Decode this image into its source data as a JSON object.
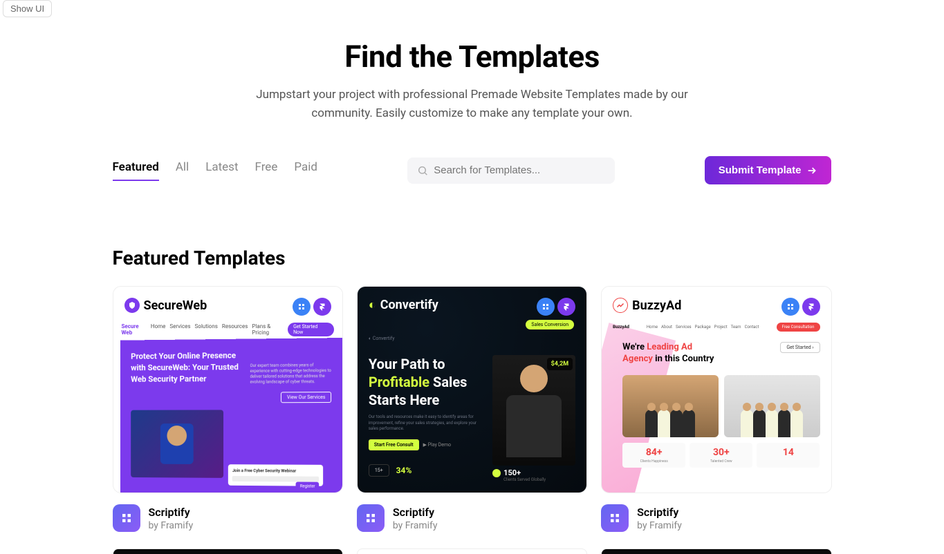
{
  "showUiLabel": "Show UI",
  "hero": {
    "title": "Find the Templates",
    "subtitle": "Jumpstart your project with professional Premade Website Templates made by our community. Easily customize to make any template your own."
  },
  "tabs": {
    "items": [
      "Featured",
      "All",
      "Latest",
      "Free",
      "Paid"
    ],
    "activeIndex": 0
  },
  "search": {
    "placeholder": "Search for Templates..."
  },
  "submitLabel": "Submit Template",
  "sectionTitle": "Featured Templates",
  "cards": [
    {
      "brand": "SecureWeb",
      "brandColor": "#7c3aed",
      "title": "Scriptify",
      "author": "by Framify",
      "preview": {
        "brandSmall": "Secure Web",
        "navLinks": [
          "Home",
          "Services",
          "Solutions",
          "Resources",
          "Plans & Pricing"
        ],
        "ctaLabel": "Get Started Now",
        "headline": "Protect Your Online Presence with SecureWeb: Your Trusted Web Security Partner",
        "desc": "Our expert team combines years of experience with cutting-edge technologies to deliver tailored solutions that address the evolving landscape of cyber threats.",
        "btnOutline": "View Our Services",
        "card1Title": "Join a Free Cyber Security Webinar",
        "card1Btn": "Register"
      }
    },
    {
      "brand": "Convertify",
      "brandColor": "#d4ff3f",
      "title": "Scriptify",
      "author": "by Framify",
      "preview": {
        "pill": "Sales Conversion",
        "subnav": "Convertify",
        "line1": "Your Path to",
        "line2a": "Profitable",
        "line2b": " Sales",
        "line3": "Starts Here",
        "desc": "Our tools and resources make it easy to identify areas for improvement, refine your sales strategies, and explore your sales performance.",
        "ctaBtn": "Start Free Consult",
        "link": "Play Demo",
        "metric": "$4,2M",
        "statBox": "15+",
        "statBig": "34%",
        "stat150": "150+",
        "stat150Label": "Clients Served Globally"
      }
    },
    {
      "brand": "BuzzyAd",
      "brandColor": "#ef4444",
      "title": "Scriptify",
      "author": "by Framify",
      "preview": {
        "brandSmall": "BuzzyAd",
        "navLinks": [
          "Home",
          "About",
          "Services",
          "Package",
          "Project",
          "Team",
          "Contact"
        ],
        "ctaLabel": "Free Consultation",
        "headlinePre": "We're ",
        "headlineRed1": "Leading Ad",
        "headlineRed2": "Agency",
        "headlinePost": " in this Country",
        "outlineBtn": "Get Started  ›",
        "stats": [
          {
            "num": "84+",
            "lbl": "Clients Happiness"
          },
          {
            "num": "30+",
            "lbl": "Talented Crew"
          },
          {
            "num": "14",
            "lbl": ""
          }
        ]
      }
    }
  ]
}
